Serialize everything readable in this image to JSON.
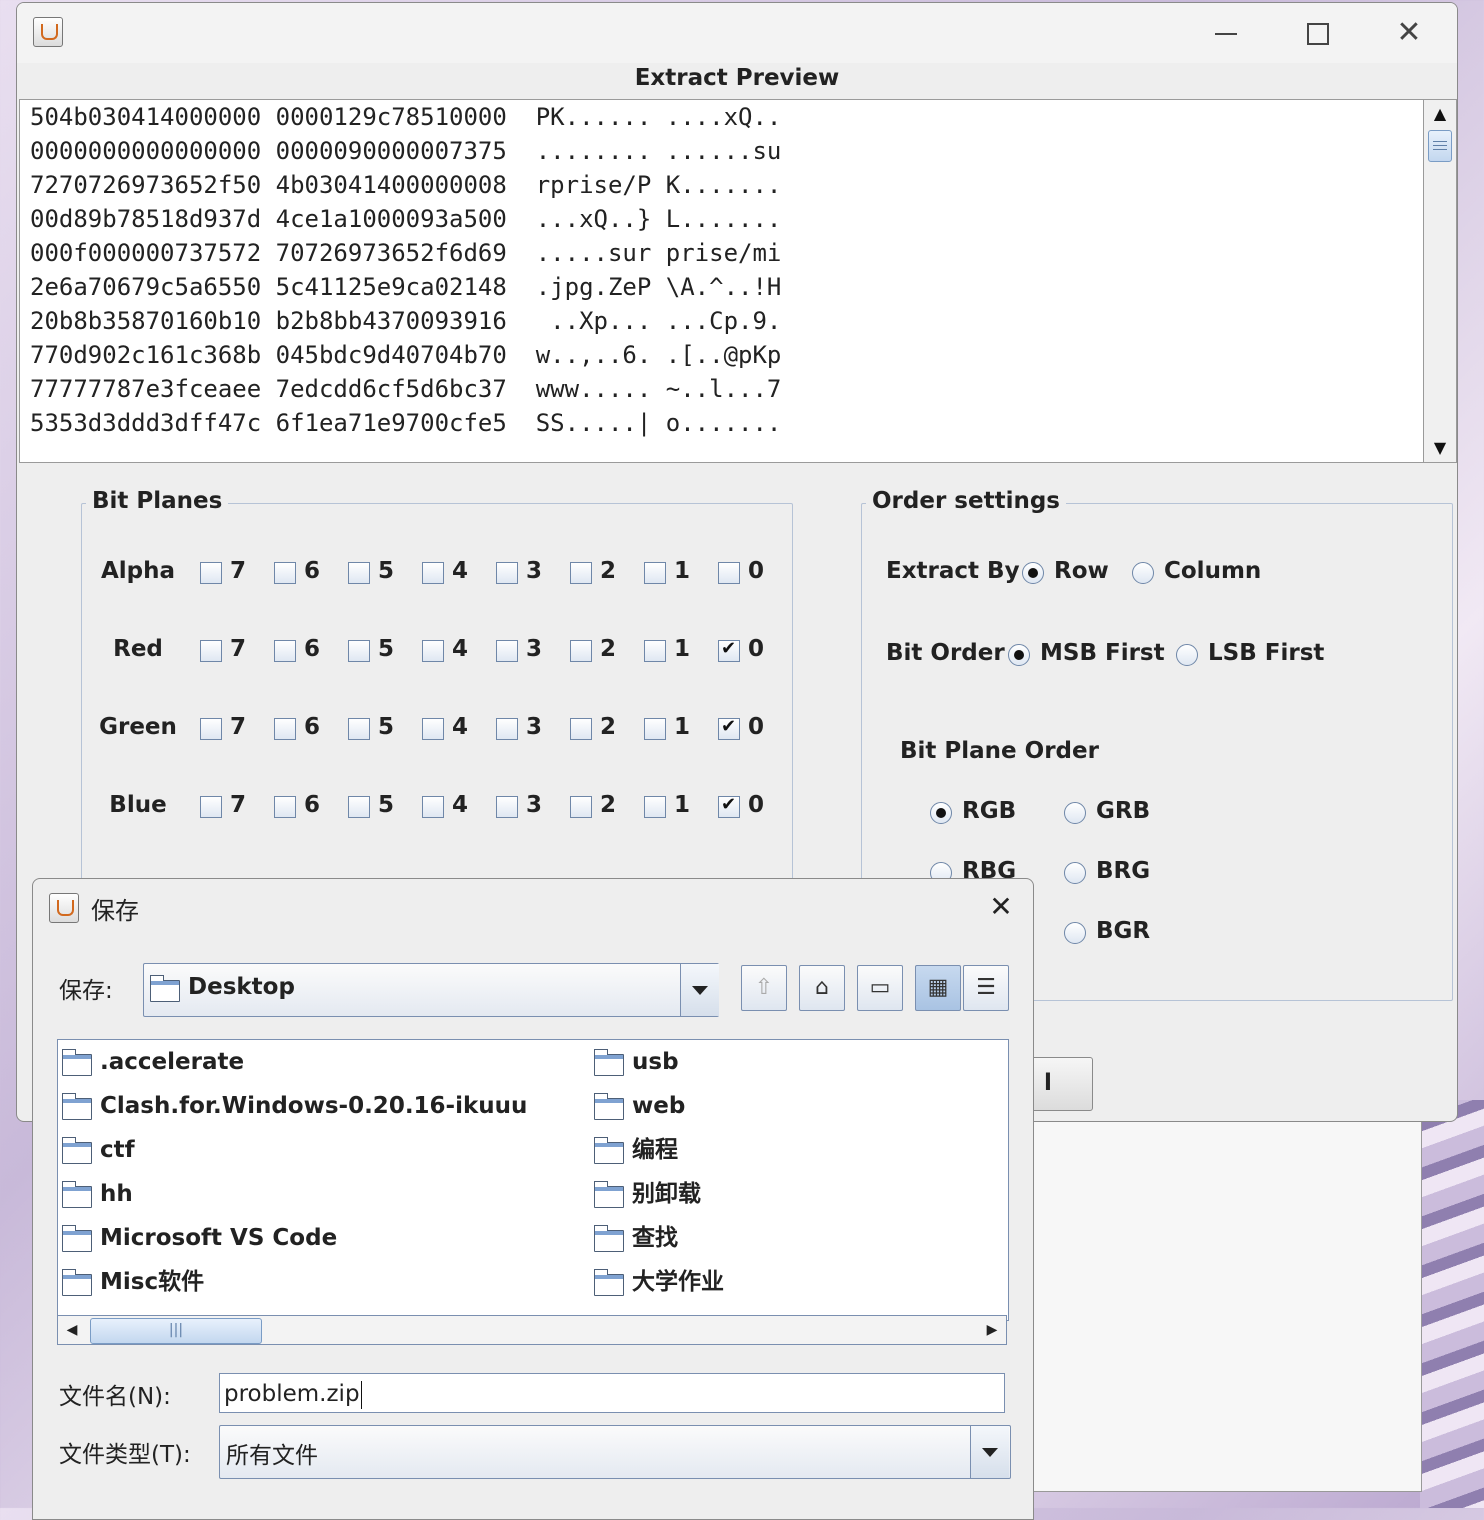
{
  "main_window": {
    "title": "Extract Preview",
    "hex_lines": [
      "504b030414000000 0000129c78510000  PK...... ....xQ..",
      "0000000000000000 0000090000007375  ........ ......su",
      "7270726973652f50 4b03041400000008  rprise/P K.......",
      "00d89b78518d937d 4ce1a1000093a500  ...xQ..} L.......",
      "000f000000737572 70726973652f6d69  .....sur prise/mi",
      "2e6a70679c5a6550 5c41125e9ca02148  .jpg.ZeP \\A.^..!H",
      "20b8b35870160b10 b2b8bb4370093916   ..Xp... ...Cp.9.",
      "770d902c161c368b 045bdc9d40704b70  w..,..6. .[..@pKp",
      "77777787e3fceaee 7edcdd6cf5d6bc37  www..... ~..l...7",
      "5353d3ddd3dff47c 6f1ea71e9700cfe5  SS.....| o......."
    ]
  },
  "bit_planes": {
    "title": "Bit Planes",
    "bits": [
      "7",
      "6",
      "5",
      "4",
      "3",
      "2",
      "1",
      "0"
    ],
    "rows": [
      {
        "label": "Alpha",
        "checked": []
      },
      {
        "label": "Red",
        "checked": [
          "0"
        ]
      },
      {
        "label": "Green",
        "checked": [
          "0"
        ]
      },
      {
        "label": "Blue",
        "checked": [
          "0"
        ]
      }
    ]
  },
  "order_settings": {
    "title": "Order settings",
    "extract_by": {
      "label": "Extract By",
      "options": [
        "Row",
        "Column"
      ],
      "selected": "Row"
    },
    "bit_order": {
      "label": "Bit Order",
      "options": [
        "MSB First",
        "LSB First"
      ],
      "selected": "MSB First"
    },
    "bit_plane_order": {
      "label": "Bit Plane Order",
      "options": [
        "RGB",
        "GRB",
        "RBG",
        "BRG",
        "BGR"
      ],
      "selected": "RGB"
    }
  },
  "save_dialog": {
    "title": "保存",
    "save_in_label": "保存:",
    "location": "Desktop",
    "files_left": [
      ".accelerate",
      "Clash.for.Windows-0.20.16-ikuuu",
      "ctf",
      "hh",
      "Microsoft VS Code",
      "Misc软件"
    ],
    "files_right": [
      "usb",
      "web",
      "编程",
      "别卸载",
      "查找",
      "大学作业"
    ],
    "filename_label": "文件名(N):",
    "filename_value": "problem.zip",
    "filetype_label": "文件类型(T):",
    "filetype_value": "所有文件"
  },
  "behind_button_text": "l"
}
